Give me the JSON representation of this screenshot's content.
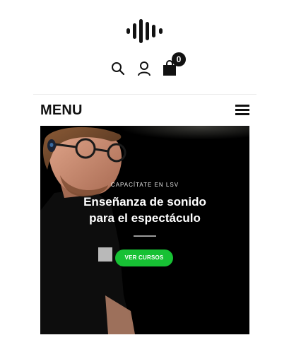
{
  "header": {
    "logo_icon": "soundwave-logo-icon",
    "icons": {
      "search": "search-icon",
      "account": "user-icon",
      "cart": "shopping-bag-icon"
    },
    "cart_count": "0"
  },
  "nav": {
    "menu_label": "MENU",
    "menu_icon": "hamburger-icon"
  },
  "hero": {
    "overline": "CAPACÍTATE EN LSV",
    "title_line1": "Enseñanza de sonido",
    "title_line2": "para el espectáculo",
    "button_label": "VER CURSOS",
    "button_color": "#17c134"
  }
}
